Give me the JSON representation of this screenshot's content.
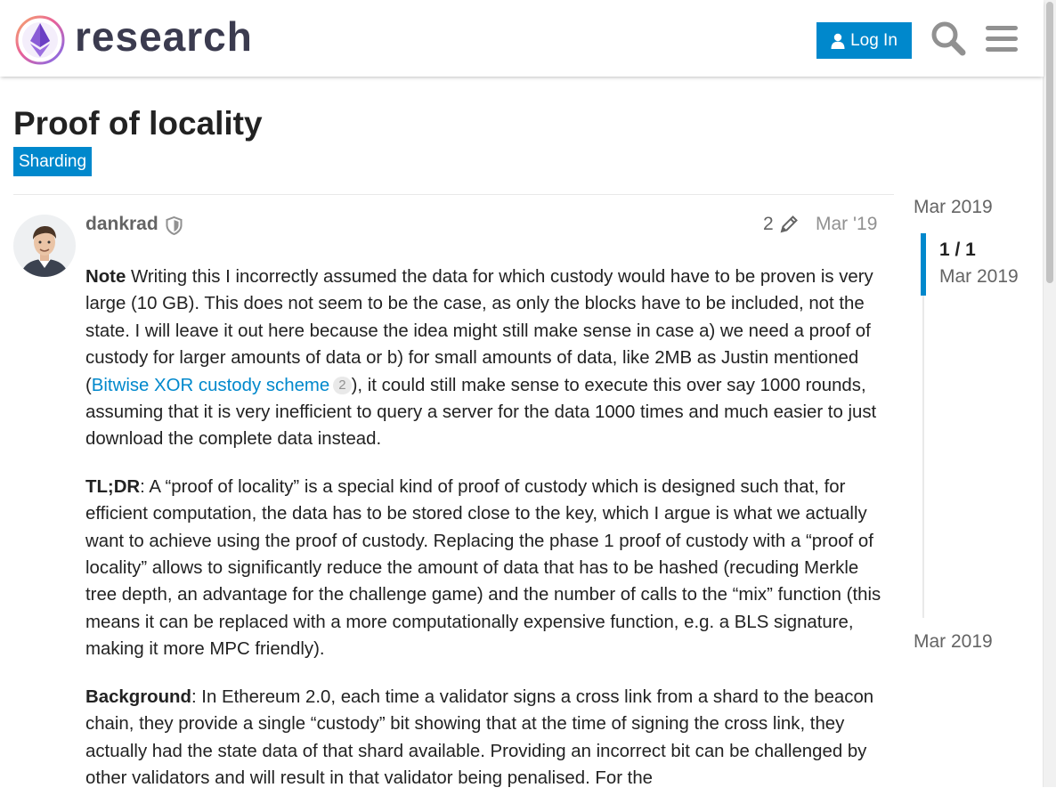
{
  "header": {
    "logo_text": "research",
    "login_label": "Log In"
  },
  "topic": {
    "title": "Proof of locality",
    "category": "Sharding"
  },
  "post": {
    "username": "dankrad",
    "edit_count": "2",
    "date": "Mar '19",
    "p1_note_label": "Note",
    "p1_text_a": " Writing this I incorrectly assumed the data for which custody would have to be proven is very large (10 GB). This does not seem to be the case, as only the blocks have to be included, not the state. I will leave it out here because the idea might still make sense in case a) we need a proof of custody for larger amounts of data or b) for small amounts of data, like 2MB as Justin mentioned (",
    "p1_link": "Bitwise XOR custody scheme",
    "p1_link_clicks": "2",
    "p1_text_b": "), it could still make sense to execute this over say 1000 rounds, assuming that it is very inefficient to query a server for the data 1000 times and much easier to just download the complete data instead.",
    "p2_label": "TL;DR",
    "p2_text": ": A “proof of locality” is a special kind of proof of custody which is designed such that, for efficient computation, the data has to be stored close to the key, which I argue is what we actually want to achieve using the proof of custody. Replacing the phase 1 proof of custody with a “proof of locality” allows to significantly reduce the amount of data that has to be hashed (recuding Merkle tree depth, an advantage for the challenge game) and the number of calls to the “mix” function (this means it can be replaced with a more computationally expensive function, e.g. a BLS signature, making it more MPC friendly).",
    "p3_label": "Background",
    "p3_text": ": In Ethereum 2.0, each time a validator signs a cross link from a shard to the beacon chain, they provide a single “custody” bit showing that at the time of signing the cross link, they actually had the state data of that shard available. Providing an incorrect bit can be challenged by other validators and will result in that validator being penalised. For the"
  },
  "timeline": {
    "start_date": "Mar 2019",
    "counter": "1 / 1",
    "counter_date": "Mar 2019",
    "end_date": "Mar 2019"
  },
  "colors": {
    "accent": "#0088cc",
    "text_muted": "#646464"
  }
}
